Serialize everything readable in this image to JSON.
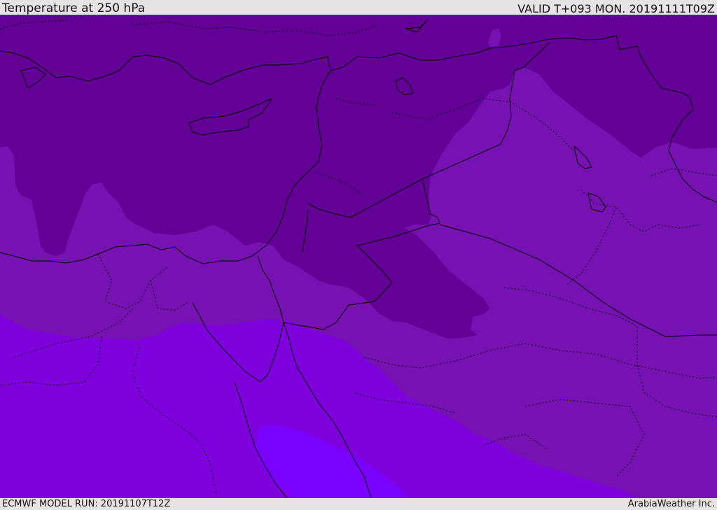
{
  "header": {
    "title": "Temperature at 250 hPa",
    "valid": "VALID T+093 MON. 20191111T09Z"
  },
  "footer": {
    "model_run": "ECMWF MODEL RUN: 20191107T12Z",
    "credit": "ArabiaWeather Inc."
  },
  "colors": {
    "darkest": "#630096",
    "dark": "#7612b2",
    "medium": "#7e00dc",
    "light": "#7a00ff",
    "border": "#000000"
  }
}
